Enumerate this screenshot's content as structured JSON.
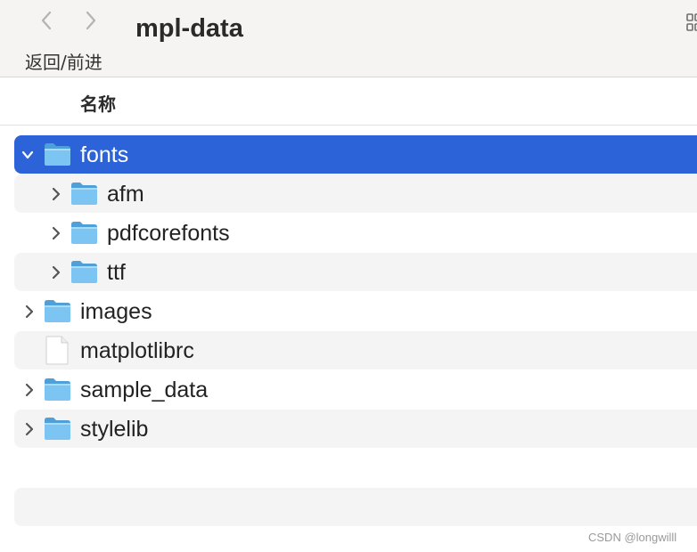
{
  "toolbar": {
    "title": "mpl-data",
    "nav_caption": "返回/前进",
    "back_icon": "chevron-left-icon",
    "forward_icon": "chevron-right-icon"
  },
  "columns": {
    "name": "名称"
  },
  "colors": {
    "selection": "#2d63d8",
    "folder": "#5fb0ea",
    "alt_row": "#f4f4f4"
  },
  "files": [
    {
      "name": "fonts",
      "type": "folder",
      "expanded": true,
      "selected": true
    },
    {
      "name": "afm",
      "type": "folder",
      "expanded": false,
      "indent": 1
    },
    {
      "name": "pdfcorefonts",
      "type": "folder",
      "expanded": false,
      "indent": 1
    },
    {
      "name": "ttf",
      "type": "folder",
      "expanded": false,
      "indent": 1
    },
    {
      "name": "images",
      "type": "folder",
      "expanded": false
    },
    {
      "name": "matplotlibrc",
      "type": "file"
    },
    {
      "name": "sample_data",
      "type": "folder",
      "expanded": false
    },
    {
      "name": "stylelib",
      "type": "folder",
      "expanded": false
    }
  ],
  "credit": "CSDN @longwilll"
}
